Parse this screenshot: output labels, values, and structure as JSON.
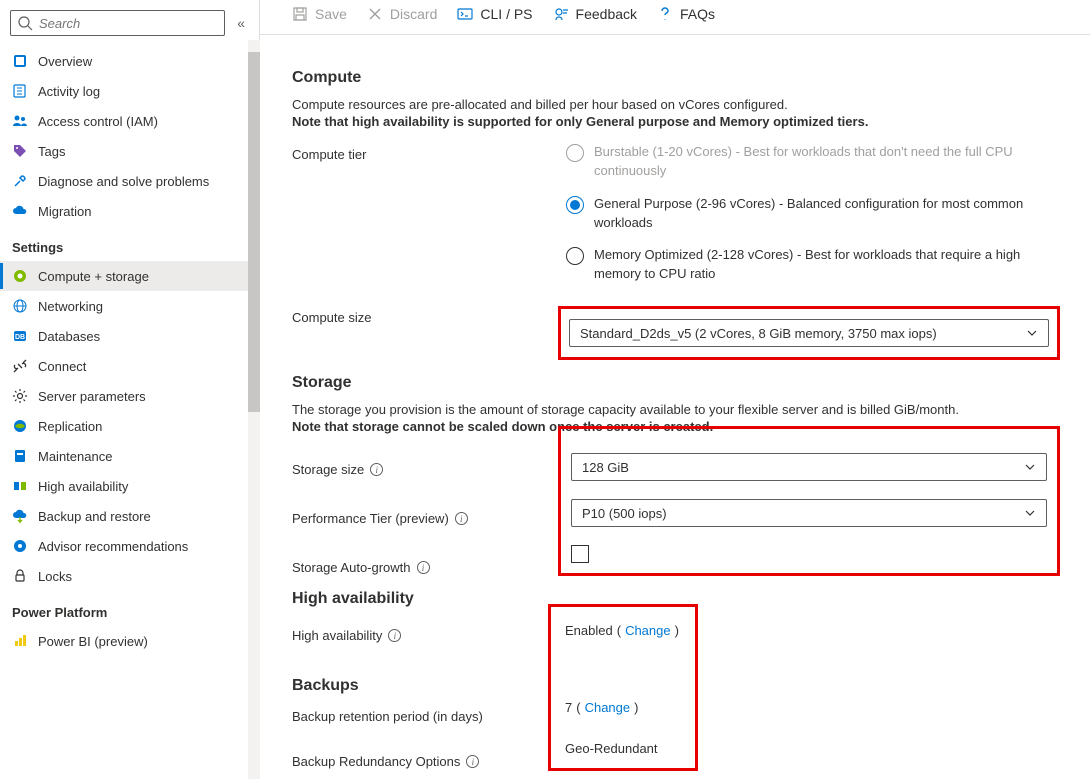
{
  "sidebar": {
    "searchPlaceholder": "Search",
    "nav1": [
      {
        "label": "Overview"
      },
      {
        "label": "Activity log"
      },
      {
        "label": "Access control (IAM)"
      },
      {
        "label": "Tags"
      },
      {
        "label": "Diagnose and solve problems"
      },
      {
        "label": "Migration"
      }
    ],
    "settingsHeader": "Settings",
    "settings": [
      {
        "label": "Compute + storage"
      },
      {
        "label": "Networking"
      },
      {
        "label": "Databases"
      },
      {
        "label": "Connect"
      },
      {
        "label": "Server parameters"
      },
      {
        "label": "Replication"
      },
      {
        "label": "Maintenance"
      },
      {
        "label": "High availability"
      },
      {
        "label": "Backup and restore"
      },
      {
        "label": "Advisor recommendations"
      },
      {
        "label": "Locks"
      }
    ],
    "powerHeader": "Power Platform",
    "power": [
      {
        "label": "Power BI (preview)"
      }
    ]
  },
  "toolbar": {
    "save": "Save",
    "discard": "Discard",
    "cli": "CLI / PS",
    "feedback": "Feedback",
    "faqs": "FAQs"
  },
  "compute": {
    "title": "Compute",
    "lead1": "Compute resources are pre-allocated and billed per hour based on vCores configured.",
    "lead2": "Note that high availability is supported for only General purpose and Memory optimized tiers.",
    "tierLabel": "Compute tier",
    "tiers": {
      "burstable": "Burstable (1-20 vCores) - Best for workloads that don't need the full CPU continuously",
      "general": "General Purpose (2-96 vCores) - Balanced configuration for most common workloads",
      "memory": "Memory Optimized (2-128 vCores) - Best for workloads that require a high memory to CPU ratio"
    },
    "sizeLabel": "Compute size",
    "sizeValue": "Standard_D2ds_v5 (2 vCores, 8 GiB memory, 3750 max iops)"
  },
  "storage": {
    "title": "Storage",
    "lead1": "The storage you provision is the amount of storage capacity available to your flexible server and is billed GiB/month.",
    "lead2": "Note that storage cannot be scaled down once the server is created.",
    "sizeLabel": "Storage size",
    "sizeValue": "128 GiB",
    "perfLabel": "Performance Tier (preview)",
    "perfValue": "P10 (500 iops)",
    "autoLabel": "Storage Auto-growth"
  },
  "ha": {
    "title": "High availability",
    "label": "High availability",
    "value": "Enabled",
    "change": "Change"
  },
  "backups": {
    "title": "Backups",
    "retentionLabel": "Backup retention period (in days)",
    "retentionValue": "7",
    "change": "Change",
    "redundancyLabel": "Backup Redundancy Options",
    "redundancyValue": "Geo-Redundant"
  }
}
